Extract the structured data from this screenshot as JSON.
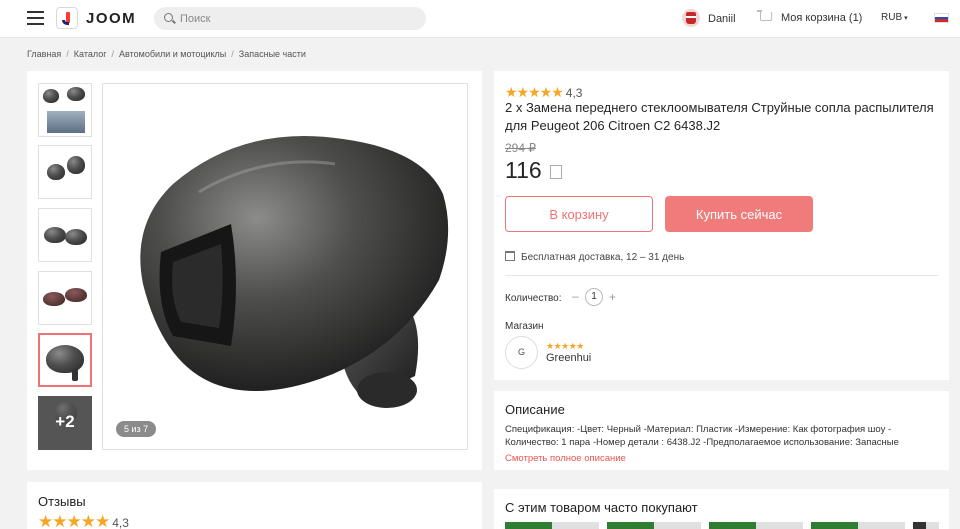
{
  "header": {
    "logo_text": "JOOM",
    "search_placeholder": "Поиск",
    "user_name": "Daniil",
    "cart_label": "Моя корзина (1)",
    "currency": "RUB",
    "currency_caret": "▾"
  },
  "breadcrumb": [
    "Главная",
    "Каталог",
    "Автомобили и мотоциклы",
    "Запасные части"
  ],
  "breadcrumb_separator": "/",
  "gallery": {
    "more_label": "+2",
    "counter": "5 из 7",
    "current_index": 5,
    "total": 7
  },
  "product": {
    "stars": "★★★★★",
    "rating": "4,3",
    "title": "2 x Замена переднего стеклоомывателя Струйные сопла распылителя для Peugeot 206 Citroen C2 6438.J2",
    "old_price": "294 ₽",
    "price": "116",
    "add_to_cart": "В корзину",
    "buy_now": "Купить сейчас",
    "delivery": "Бесплатная доставка, 12 – 31 день",
    "quantity_label": "Количество:",
    "quantity_minus": "–",
    "quantity_value": "1",
    "quantity_plus": "+",
    "shop_label": "Магазин",
    "shop_initial": "G",
    "shop_stars": "★★★★★",
    "shop_name": "Greenhui"
  },
  "description": {
    "title": "Описание",
    "text": "Спецификация: -Цвет: Черный -Материал: Пластик -Измерение: Как фотография шоу - Количество: 1 пара -Номер детали : 6438.J2 -Предполагаемое использование: Запасные",
    "link": "Смотреть полное описание"
  },
  "reviews": {
    "title": "Отзывы",
    "stars": "★★★★★",
    "rating": "4,3"
  },
  "often_bought": {
    "title": "С этим товаром часто покупают"
  },
  "colors": {
    "accent": "#ef7373",
    "star": "#f5a623",
    "flag": [
      "#ffffff",
      "#1e4fc2",
      "#d52b1e"
    ]
  }
}
